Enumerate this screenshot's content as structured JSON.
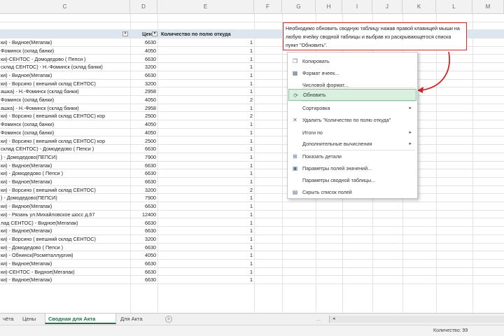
{
  "columns": [
    "C",
    "D",
    "E",
    "F",
    "G",
    "H",
    "I",
    "J",
    "K",
    "L",
    "M"
  ],
  "table": {
    "headers": {
      "price": "Цены",
      "qty": "Количество по полю откуда"
    },
    "rows": [
      {
        "name": "ки) - Видное(Мегапак)",
        "price": "6630",
        "qty": "1"
      },
      {
        "name": "Фоминск (склад банки)",
        "price": "4050",
        "qty": "1"
      },
      {
        "name": "ки)-СЕНТОС - Домодедово ( Пепси )",
        "price": "6630",
        "qty": "1"
      },
      {
        "name": "склад СЕНТОС) - Н.-Фоминск (склад банки)",
        "price": "3200",
        "qty": "1"
      },
      {
        "name": "ки) - Видное(Мегапак)",
        "price": "6630",
        "qty": "1"
      },
      {
        "name": "ки) - Ворсино ( внешний склад СЕНТОС)",
        "price": "3200",
        "qty": "1"
      },
      {
        "name": "ашка) - Н.-Фоминск (склад банки)",
        "price": "2958",
        "qty": "1"
      },
      {
        "name": "Фоминск (склад банки)",
        "price": "4050",
        "qty": "2"
      },
      {
        "name": "ашка) - Н.-Фоминск (склад банки)",
        "price": "2958",
        "qty": "1"
      },
      {
        "name": "ки) - Ворсино ( внешний склад СЕНТОС) кор",
        "price": "2500",
        "qty": "2"
      },
      {
        "name": "Фоминск (склад банки)",
        "price": "4050",
        "qty": "1"
      },
      {
        "name": "Фоминск (склад банки)",
        "price": "4050",
        "qty": "1"
      },
      {
        "name": "ки) - Ворсино ( внешний склад СЕНТОС) кор",
        "price": "2500",
        "qty": "1"
      },
      {
        "name": "склад СЕНТОС) - Домодедово ( Пепси )",
        "price": "6630",
        "qty": "1"
      },
      {
        "name": ") - Домодедово(ПЕПСИ)",
        "price": "7900",
        "qty": "1"
      },
      {
        "name": "ки) - Видное(Мегапак)",
        "price": "6630",
        "qty": "1"
      },
      {
        "name": "ки) - Домодедово ( Пепси )",
        "price": "6630",
        "qty": "1"
      },
      {
        "name": "ки) - Видное(Мегапак)",
        "price": "6630",
        "qty": "1"
      },
      {
        "name": "ки) - Ворсино ( внешний склад СЕНТОС)",
        "price": "3200",
        "qty": "2"
      },
      {
        "name": ") - Домодедово(ПЕПСИ)",
        "price": "7900",
        "qty": "1"
      },
      {
        "name": "ки) - Видное(Мегапак)",
        "price": "6630",
        "qty": "1"
      },
      {
        "name": "ки) - Рязань ул.Михайловское шосс д.67",
        "price": "12400",
        "qty": "1"
      },
      {
        "name": "лад СЕНТОС) - Видное(Мегапак)",
        "price": "6630",
        "qty": "1"
      },
      {
        "name": "ки) - Видное(Мегапак)",
        "price": "6630",
        "qty": "1"
      },
      {
        "name": "ки) - Ворсино ( внешний склад СЕНТОС)",
        "price": "3200",
        "qty": "1"
      },
      {
        "name": "ки) - Домодедово ( Пепси )",
        "price": "6630",
        "qty": "1"
      },
      {
        "name": "ки) - Обнинск(Росметаллургия)",
        "price": "4050",
        "qty": "1"
      },
      {
        "name": "ки) - Видное(Мегапак)",
        "price": "6630",
        "qty": "1"
      },
      {
        "name": "ки)-СЕНТОС - Видное(Мегапак)",
        "price": "6630",
        "qty": "1"
      },
      {
        "name": "ки) - Видное(Мегапак)",
        "price": "6630",
        "qty": "1"
      }
    ]
  },
  "note": {
    "text": "Необходимо обновить сводную таблицу нажав правой клавищей мыши на любую ячейку сводной таблицы и выбрав из раскрывающегося списка пункт \"Обновить\"."
  },
  "context_menu": {
    "items": [
      {
        "label": "Копировать",
        "icon": "copy-icon",
        "glyph": "❐"
      },
      {
        "label": "Формат ячеек...",
        "icon": "format-cells-icon",
        "glyph": "▦"
      },
      {
        "label": "Числовой формат...",
        "icon": "",
        "glyph": ""
      },
      {
        "label": "Обновить",
        "icon": "refresh-icon",
        "glyph": "⟳"
      },
      {
        "label": "Сортировка",
        "icon": "",
        "glyph": ""
      },
      {
        "label": "Удалить \"Количество по полю откуда\"",
        "icon": "delete-icon",
        "glyph": "✕"
      },
      {
        "label": "Итоги по",
        "icon": "",
        "glyph": ""
      },
      {
        "label": "Дополнительные вычисления",
        "icon": "",
        "glyph": ""
      },
      {
        "label": "Показать детали",
        "icon": "details-icon",
        "glyph": "⊞"
      },
      {
        "label": "Параметры полей значений...",
        "icon": "field-settings-icon",
        "glyph": "▣"
      },
      {
        "label": "Параметры сводной таблицы...",
        "icon": "",
        "glyph": ""
      },
      {
        "label": "Скрыть список полей",
        "icon": "field-list-icon",
        "glyph": "▤"
      }
    ],
    "highlighted": "Обновить",
    "submenu_arrow": "▸"
  },
  "tabs": {
    "items": [
      {
        "label": "чёта",
        "active": false
      },
      {
        "label": "Цены",
        "active": false
      },
      {
        "label": "Сводная для Акта",
        "active": true
      },
      {
        "label": "Для Акта",
        "active": false
      }
    ],
    "add_label": "+",
    "ellipsis": "..."
  },
  "status": {
    "count": "Количество: 99"
  },
  "colors": {
    "accent": "#217346",
    "note_border": "#d12a2a",
    "menu_highlight": "#d9efdf",
    "table_header": "#dce6f1"
  }
}
